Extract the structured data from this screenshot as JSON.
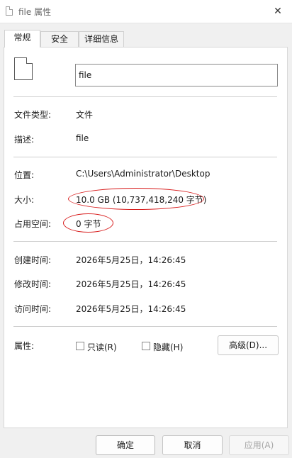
{
  "window": {
    "title": "file 属性",
    "close_glyph": "✕"
  },
  "tabs": [
    {
      "label": "常规",
      "active": true
    },
    {
      "label": "安全",
      "active": false
    },
    {
      "label": "详细信息",
      "active": false
    }
  ],
  "general": {
    "file_name": "file",
    "type_label": "文件类型:",
    "type_value": "文件",
    "desc_label": "描述:",
    "desc_value": "file",
    "location_label": "位置:",
    "location_value": "C:\\Users\\Administrator\\Desktop",
    "size_label": "大小:",
    "size_value": "10.0 GB (10,737,418,240 字节)",
    "size_on_disk_label": "占用空间:",
    "size_on_disk_value": "0 字节",
    "created_label": "创建时间:",
    "created_value": "2026年5月25日，14:26:45",
    "modified_label": "修改时间:",
    "modified_value": "2026年5月25日，14:26:45",
    "accessed_label": "访问时间:",
    "accessed_value": "2026年5月25日，14:26:45",
    "attributes_label": "属性:",
    "readonly_label": "只读(R)",
    "hidden_label": "隐藏(H)",
    "advanced_label": "高级(D)..."
  },
  "footer": {
    "ok_label": "确定",
    "cancel_label": "取消",
    "apply_label": "应用(A)"
  },
  "colors": {
    "annotation_ring": "#d81e1e"
  }
}
